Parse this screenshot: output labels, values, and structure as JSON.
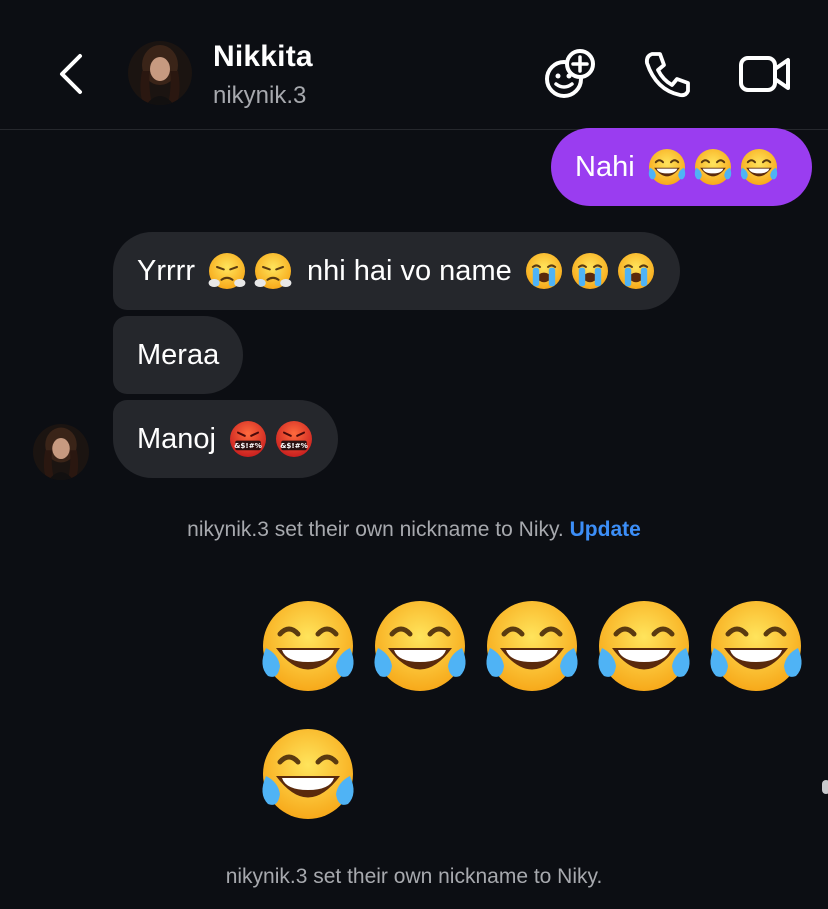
{
  "header": {
    "name": "Nikkita",
    "handle": "nikynik.3",
    "icons": [
      "back-chevron-icon",
      "effects-icon",
      "phone-icon",
      "video-camera-icon"
    ]
  },
  "messages": {
    "outgoing_1": {
      "text": "Nahi",
      "emoji": [
        "tears-of-joy",
        "tears-of-joy",
        "tears-of-joy"
      ]
    },
    "incoming_1": {
      "text_a": "Yrrrr",
      "emoji_a": [
        "steam-from-nose",
        "steam-from-nose"
      ],
      "text_b": "nhi hai vo name",
      "emoji_b": [
        "loudly-crying",
        "loudly-crying",
        "loudly-crying"
      ]
    },
    "incoming_2": {
      "text": "Meraa"
    },
    "incoming_3": {
      "text": "Manoj",
      "emoji": [
        "face-with-symbols",
        "face-with-symbols"
      ]
    },
    "big_emoji_count": 6
  },
  "system": {
    "notice_1": "nikynik.3 set their own nickname to Niky.",
    "notice_1_link": "Update",
    "notice_2": "nikynik.3 set their own nickname to Niky."
  },
  "colors": {
    "background": "#0c0e13",
    "outgoing_bubble": "#9a3df0",
    "incoming_bubble": "#25272c",
    "link": "#3c8ef7"
  }
}
